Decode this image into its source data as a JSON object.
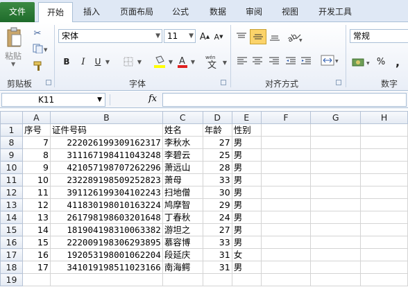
{
  "tabs": {
    "file": "文件",
    "items": [
      "开始",
      "插入",
      "页面布局",
      "公式",
      "数据",
      "审阅",
      "视图",
      "开发工具"
    ],
    "active": "开始"
  },
  "ribbon": {
    "clipboard": {
      "paste_label": "粘贴",
      "group_label": "剪贴板"
    },
    "font": {
      "name": "宋体",
      "size": "11",
      "bold": "B",
      "italic": "I",
      "underline": "U",
      "group_label": "字体"
    },
    "alignment": {
      "group_label": "对齐方式"
    },
    "number": {
      "format": "常规",
      "percent": "%",
      "comma": ",",
      "group_label": "数字"
    }
  },
  "formula_bar": {
    "name_box": "K11",
    "fx": "fx",
    "formula": ""
  },
  "sheet": {
    "columns": [
      "A",
      "B",
      "C",
      "D",
      "E",
      "F",
      "G",
      "H"
    ],
    "header_row": {
      "row": "1",
      "a": "序号",
      "b": "证件号码",
      "c": "姓名",
      "d": "年龄",
      "e": "性别"
    },
    "rows": [
      {
        "row": "8",
        "a": "7",
        "b": "222026199309162317",
        "c": "李秋水",
        "d": "27",
        "e": "男"
      },
      {
        "row": "9",
        "a": "8",
        "b": "311167198411043248",
        "c": "李碧云",
        "d": "25",
        "e": "男"
      },
      {
        "row": "10",
        "a": "9",
        "b": "421057198707262296",
        "c": "萧远山",
        "d": "28",
        "e": "男"
      },
      {
        "row": "11",
        "a": "10",
        "b": "232289198509252823",
        "c": "萧母",
        "d": "33",
        "e": "男"
      },
      {
        "row": "12",
        "a": "11",
        "b": "391126199304102243",
        "c": "扫地僧",
        "d": "30",
        "e": "男"
      },
      {
        "row": "13",
        "a": "12",
        "b": "411830198010163224",
        "c": "鸠摩智",
        "d": "29",
        "e": "男"
      },
      {
        "row": "14",
        "a": "13",
        "b": "261798198603201648",
        "c": "丁春秋",
        "d": "24",
        "e": "男"
      },
      {
        "row": "15",
        "a": "14",
        "b": "181904198310063382",
        "c": "游坦之",
        "d": "27",
        "e": "男"
      },
      {
        "row": "16",
        "a": "15",
        "b": "222009198306293895",
        "c": "慕容博",
        "d": "33",
        "e": "男"
      },
      {
        "row": "17",
        "a": "16",
        "b": "192053198001062204",
        "c": "段延庆",
        "d": "31",
        "e": "女"
      },
      {
        "row": "18",
        "a": "17",
        "b": "341019198511023166",
        "c": "南海鳄",
        "d": "31",
        "e": "男"
      },
      {
        "row": "19",
        "a": "",
        "b": "",
        "c": "",
        "d": "",
        "e": ""
      }
    ]
  },
  "colors": {
    "file_tab": "#2a7a35",
    "ribbon_bg": "#e9eef7",
    "header_bg": "#e4eaf3",
    "font_color_red": "#e02020",
    "highlight_yellow": "#ffff00"
  }
}
